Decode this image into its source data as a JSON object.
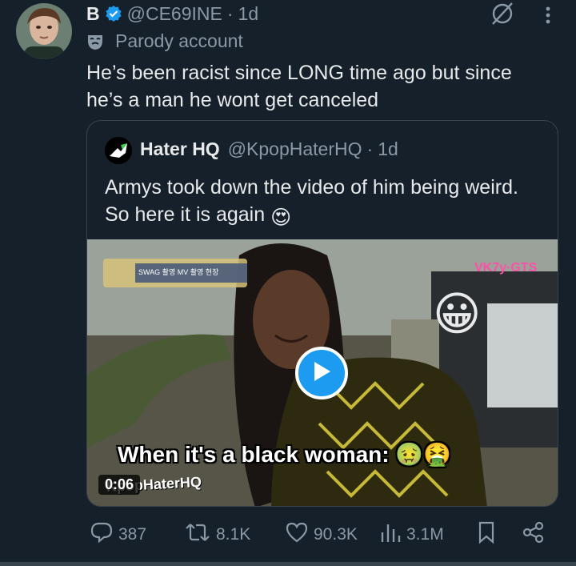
{
  "post": {
    "display_name": "B",
    "handle": "@CE69INE",
    "time": "1d",
    "label": "Parody account",
    "text": "He’s been racist since LONG time ago but since he’s a man he wont get canceled"
  },
  "quote": {
    "display_name": "Hater HQ",
    "handle": "@KpopHaterHQ",
    "time": "1d",
    "text_line1": "Armys took down the video of him being weird.",
    "text_line2": "So here it is again",
    "emoji": "😍"
  },
  "video": {
    "caption": "When it's a black woman:",
    "caption_emojis": "🤢🤮",
    "timestamp": "0:06",
    "watermark": "KpopHaterHQ",
    "overlay_emoji": "😀",
    "banner_text": "SWAG 촬영 MV 촬영 현장"
  },
  "actions": {
    "replies": "387",
    "reposts": "8.1K",
    "likes": "90.3K",
    "views": "3.1M"
  },
  "colors": {
    "background": "#15202b",
    "text": "#e7e9ea",
    "muted": "#8b98a5",
    "border": "#38444d",
    "verified": "#1d9bf0",
    "play": "#1d9bf0"
  }
}
